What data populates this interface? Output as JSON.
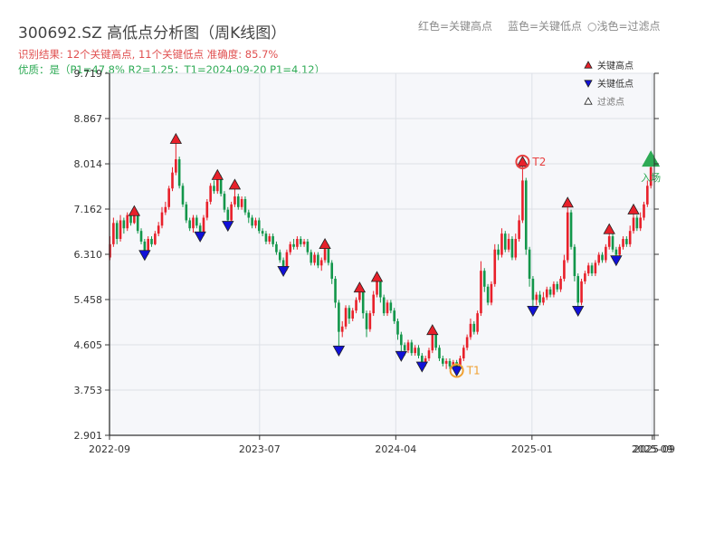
{
  "title": "300692.SZ 高低点分析图（周K线图）",
  "legend_top": {
    "red": "红色=关键高点",
    "blue": "蓝色=关键低点",
    "gray": "○浅色=过滤点"
  },
  "info_line1": "识别结果: 12个关键高点, 11个关键低点  准确度: 85.7%",
  "info_line2": "优质：是（P1=47.8%  R2=1.25；T1=2024-09-20 P1=4.12）",
  "colors": {
    "up": "#e8202a",
    "down": "#12964a",
    "high_marker": "#e8202a",
    "low_marker": "#1010d8",
    "t1": "#f0a030",
    "t2": "#e84040",
    "entry": "#2eaa55",
    "plot_bg": "#f6f7fa",
    "grid": "#dde1e7"
  },
  "chart_data": {
    "type": "candlestick",
    "legend": {
      "placement": "top-right",
      "entries": [
        "关键高点",
        "关键低点",
        "过滤点"
      ]
    },
    "y_ticks": [
      "2.901",
      "3.753",
      "4.605",
      "5.458",
      "6.310",
      "7.162",
      "8.014",
      "8.867",
      "9.719"
    ],
    "ylim": [
      2.901,
      9.719
    ],
    "x_ticks": [
      {
        "label": "2022-09",
        "date": "2022-09-01"
      },
      {
        "label": "2023-07",
        "date": "2023-07-01"
      },
      {
        "label": "2024-04",
        "date": "2024-04-01"
      },
      {
        "label": "2025-01",
        "date": "2025-01-01"
      },
      {
        "label": "2025-09",
        "date": "2025-09-01"
      },
      {
        "label": "2025-09",
        "date": "2025-09-05"
      }
    ],
    "xlim": [
      "2022-09-01",
      "2025-09-05"
    ],
    "grid": true,
    "candles": [
      [
        "2022-09-02",
        6.25,
        6.5,
        6.65,
        6.2
      ],
      [
        "2022-09-09",
        6.5,
        6.9,
        7.0,
        6.45
      ],
      [
        "2022-09-16",
        6.9,
        6.6,
        6.95,
        6.5
      ],
      [
        "2022-09-23",
        6.6,
        6.95,
        7.05,
        6.55
      ],
      [
        "2022-09-30",
        6.95,
        6.8,
        7.0,
        6.7
      ],
      [
        "2022-10-07",
        6.8,
        7.05,
        7.1,
        6.75
      ],
      [
        "2022-10-14",
        7.05,
        6.9,
        7.1,
        6.85
      ],
      [
        "2022-10-21",
        6.9,
        7.05,
        7.12,
        6.88
      ],
      [
        "2022-10-28",
        7.05,
        6.75,
        7.08,
        6.7
      ],
      [
        "2022-11-04",
        6.75,
        6.55,
        6.8,
        6.5
      ],
      [
        "2022-11-11",
        6.55,
        6.35,
        6.6,
        6.3
      ],
      [
        "2022-11-18",
        6.35,
        6.6,
        6.65,
        6.3
      ],
      [
        "2022-11-25",
        6.6,
        6.5,
        6.65,
        6.45
      ],
      [
        "2022-12-02",
        6.5,
        6.7,
        6.75,
        6.48
      ],
      [
        "2022-12-09",
        6.7,
        6.85,
        6.92,
        6.65
      ],
      [
        "2022-12-16",
        6.85,
        7.1,
        7.2,
        6.8
      ],
      [
        "2022-12-23",
        7.1,
        7.2,
        7.3,
        7.05
      ],
      [
        "2022-12-30",
        7.2,
        7.55,
        7.6,
        7.15
      ],
      [
        "2023-01-06",
        7.55,
        7.85,
        7.95,
        7.5
      ],
      [
        "2023-01-13",
        7.85,
        8.1,
        8.48,
        7.8
      ],
      [
        "2023-01-20",
        8.1,
        7.6,
        8.15,
        7.55
      ],
      [
        "2023-01-27",
        7.6,
        7.25,
        7.65,
        7.2
      ],
      [
        "2023-02-03",
        7.25,
        6.95,
        7.3,
        6.9
      ],
      [
        "2023-02-10",
        6.95,
        6.8,
        7.0,
        6.75
      ],
      [
        "2023-02-17",
        6.8,
        7.0,
        7.05,
        6.72
      ],
      [
        "2023-02-24",
        7.0,
        6.85,
        7.05,
        6.8
      ],
      [
        "2023-03-03",
        6.85,
        6.7,
        6.9,
        6.65
      ],
      [
        "2023-03-10",
        6.7,
        7.0,
        7.05,
        6.65
      ],
      [
        "2023-03-17",
        7.0,
        7.3,
        7.35,
        6.95
      ],
      [
        "2023-03-24",
        7.3,
        7.6,
        7.65,
        7.25
      ],
      [
        "2023-03-31",
        7.6,
        7.5,
        7.7,
        7.45
      ],
      [
        "2023-04-07",
        7.5,
        7.75,
        7.8,
        7.45
      ],
      [
        "2023-04-14",
        7.75,
        7.45,
        7.8,
        7.4
      ],
      [
        "2023-04-21",
        7.45,
        7.15,
        7.5,
        7.1
      ],
      [
        "2023-04-28",
        7.15,
        6.95,
        7.2,
        6.85
      ],
      [
        "2023-05-05",
        6.95,
        7.25,
        7.3,
        6.9
      ],
      [
        "2023-05-12",
        7.25,
        7.4,
        7.62,
        7.2
      ],
      [
        "2023-05-19",
        7.4,
        7.2,
        7.45,
        7.15
      ],
      [
        "2023-05-26",
        7.2,
        7.35,
        7.4,
        7.15
      ],
      [
        "2023-06-02",
        7.35,
        7.1,
        7.4,
        7.05
      ],
      [
        "2023-06-09",
        7.1,
        7.0,
        7.15,
        6.9
      ],
      [
        "2023-06-16",
        7.0,
        6.85,
        7.05,
        6.8
      ],
      [
        "2023-06-23",
        6.85,
        6.95,
        7.0,
        6.8
      ],
      [
        "2023-06-30",
        6.95,
        6.75,
        7.0,
        6.7
      ],
      [
        "2023-07-07",
        6.75,
        6.7,
        6.8,
        6.65
      ],
      [
        "2023-07-14",
        6.7,
        6.55,
        6.75,
        6.5
      ],
      [
        "2023-07-21",
        6.55,
        6.65,
        6.7,
        6.5
      ],
      [
        "2023-07-28",
        6.65,
        6.5,
        6.7,
        6.45
      ],
      [
        "2023-08-04",
        6.5,
        6.35,
        6.55,
        6.3
      ],
      [
        "2023-08-11",
        6.35,
        6.2,
        6.4,
        6.15
      ],
      [
        "2023-08-18",
        6.2,
        6.05,
        6.25,
        6.0
      ],
      [
        "2023-08-25",
        6.05,
        6.35,
        6.4,
        6.0
      ],
      [
        "2023-09-01",
        6.35,
        6.5,
        6.55,
        6.3
      ],
      [
        "2023-09-08",
        6.5,
        6.45,
        6.6,
        6.4
      ],
      [
        "2023-09-15",
        6.45,
        6.6,
        6.65,
        6.4
      ],
      [
        "2023-09-22",
        6.6,
        6.5,
        6.65,
        6.45
      ],
      [
        "2023-09-29",
        6.5,
        6.55,
        6.6,
        6.45
      ],
      [
        "2023-10-06",
        6.55,
        6.35,
        6.6,
        6.3
      ],
      [
        "2023-10-13",
        6.35,
        6.15,
        6.4,
        6.1
      ],
      [
        "2023-10-20",
        6.15,
        6.3,
        6.35,
        6.1
      ],
      [
        "2023-10-27",
        6.3,
        6.1,
        6.35,
        6.05
      ],
      [
        "2023-11-03",
        6.1,
        6.2,
        6.25,
        6.0
      ],
      [
        "2023-11-10",
        6.2,
        6.45,
        6.5,
        6.15
      ],
      [
        "2023-11-17",
        6.45,
        6.15,
        6.5,
        6.1
      ],
      [
        "2023-11-24",
        6.15,
        5.85,
        6.2,
        5.75
      ],
      [
        "2023-12-01",
        5.85,
        5.4,
        5.9,
        5.3
      ],
      [
        "2023-12-08",
        5.4,
        4.85,
        5.45,
        4.5
      ],
      [
        "2023-12-15",
        4.85,
        4.95,
        5.05,
        4.75
      ],
      [
        "2023-12-22",
        4.95,
        5.3,
        5.35,
        4.9
      ],
      [
        "2023-12-29",
        5.3,
        5.1,
        5.35,
        5.0
      ],
      [
        "2024-01-05",
        5.1,
        5.25,
        5.3,
        5.05
      ],
      [
        "2024-01-12",
        5.25,
        5.45,
        5.5,
        5.2
      ],
      [
        "2024-01-19",
        5.45,
        5.6,
        5.68,
        5.4
      ],
      [
        "2024-01-26",
        5.6,
        5.2,
        5.65,
        5.1
      ],
      [
        "2024-02-02",
        5.2,
        4.9,
        5.25,
        4.75
      ],
      [
        "2024-02-09",
        4.9,
        5.2,
        5.25,
        4.85
      ],
      [
        "2024-02-16",
        5.2,
        5.55,
        5.62,
        5.15
      ],
      [
        "2024-02-23",
        5.55,
        5.8,
        5.88,
        5.5
      ],
      [
        "2024-03-01",
        5.8,
        5.5,
        5.85,
        5.4
      ],
      [
        "2024-03-08",
        5.5,
        5.2,
        5.55,
        5.15
      ],
      [
        "2024-03-15",
        5.2,
        5.4,
        5.45,
        5.15
      ],
      [
        "2024-03-22",
        5.4,
        5.25,
        5.45,
        5.2
      ],
      [
        "2024-03-29",
        5.25,
        5.05,
        5.3,
        5.0
      ],
      [
        "2024-04-05",
        5.05,
        4.8,
        5.1,
        4.7
      ],
      [
        "2024-04-12",
        4.8,
        4.6,
        4.85,
        4.4
      ],
      [
        "2024-04-19",
        4.6,
        4.5,
        4.65,
        4.4
      ],
      [
        "2024-04-26",
        4.5,
        4.65,
        4.7,
        4.45
      ],
      [
        "2024-05-03",
        4.65,
        4.45,
        4.7,
        4.4
      ],
      [
        "2024-05-10",
        4.45,
        4.55,
        4.6,
        4.4
      ],
      [
        "2024-05-17",
        4.55,
        4.4,
        4.6,
        4.35
      ],
      [
        "2024-05-24",
        4.4,
        4.25,
        4.45,
        4.2
      ],
      [
        "2024-05-31",
        4.25,
        4.35,
        4.4,
        4.2
      ],
      [
        "2024-06-07",
        4.35,
        4.5,
        4.55,
        4.3
      ],
      [
        "2024-06-14",
        4.5,
        4.8,
        4.88,
        4.45
      ],
      [
        "2024-06-21",
        4.8,
        4.55,
        4.85,
        4.5
      ],
      [
        "2024-06-28",
        4.55,
        4.35,
        4.6,
        4.3
      ],
      [
        "2024-07-05",
        4.35,
        4.25,
        4.4,
        4.2
      ],
      [
        "2024-07-12",
        4.25,
        4.3,
        4.35,
        4.15
      ],
      [
        "2024-07-19",
        4.3,
        4.2,
        4.35,
        4.15
      ],
      [
        "2024-07-26",
        4.2,
        4.28,
        4.32,
        4.15
      ],
      [
        "2024-08-02",
        4.28,
        4.18,
        4.32,
        4.12
      ],
      [
        "2024-08-09",
        4.18,
        4.35,
        4.4,
        4.15
      ],
      [
        "2024-08-16",
        4.35,
        4.55,
        4.6,
        4.3
      ],
      [
        "2024-08-23",
        4.55,
        4.75,
        4.8,
        4.5
      ],
      [
        "2024-08-30",
        4.75,
        5.0,
        5.1,
        4.7
      ],
      [
        "2024-09-06",
        5.0,
        4.85,
        5.05,
        4.8
      ],
      [
        "2024-09-13",
        4.85,
        5.2,
        5.25,
        4.8
      ],
      [
        "2024-09-20",
        5.2,
        6.0,
        6.18,
        5.15
      ],
      [
        "2024-09-27",
        6.0,
        5.7,
        6.05,
        5.6
      ],
      [
        "2024-10-04",
        5.7,
        5.4,
        5.75,
        5.35
      ],
      [
        "2024-10-11",
        5.4,
        5.75,
        5.8,
        5.35
      ],
      [
        "2024-10-18",
        5.75,
        6.4,
        6.5,
        5.7
      ],
      [
        "2024-10-25",
        6.4,
        6.3,
        6.5,
        6.2
      ],
      [
        "2024-11-01",
        6.3,
        6.7,
        6.8,
        6.25
      ],
      [
        "2024-11-08",
        6.7,
        6.4,
        6.75,
        6.35
      ],
      [
        "2024-11-15",
        6.4,
        6.6,
        6.7,
        6.35
      ],
      [
        "2024-11-22",
        6.6,
        6.25,
        6.65,
        6.2
      ],
      [
        "2024-11-29",
        6.25,
        6.6,
        6.7,
        6.2
      ],
      [
        "2024-12-06",
        6.6,
        6.95,
        7.05,
        6.55
      ],
      [
        "2024-12-13",
        6.95,
        7.7,
        8.05,
        6.9
      ],
      [
        "2024-12-20",
        7.7,
        6.4,
        7.75,
        6.3
      ],
      [
        "2024-12-27",
        6.4,
        5.85,
        6.45,
        5.7
      ],
      [
        "2025-01-03",
        5.85,
        5.45,
        5.9,
        5.25
      ],
      [
        "2025-01-10",
        5.45,
        5.55,
        5.6,
        5.35
      ],
      [
        "2025-01-17",
        5.55,
        5.4,
        5.62,
        5.35
      ],
      [
        "2025-01-24",
        5.4,
        5.5,
        5.6,
        5.35
      ],
      [
        "2025-01-31",
        5.5,
        5.65,
        5.7,
        5.45
      ],
      [
        "2025-02-07",
        5.65,
        5.55,
        5.7,
        5.5
      ],
      [
        "2025-02-14",
        5.55,
        5.75,
        5.8,
        5.5
      ],
      [
        "2025-02-21",
        5.75,
        5.65,
        5.8,
        5.6
      ],
      [
        "2025-02-28",
        5.65,
        5.85,
        5.9,
        5.6
      ],
      [
        "2025-03-07",
        5.85,
        6.2,
        6.3,
        5.8
      ],
      [
        "2025-03-14",
        6.2,
        7.1,
        7.28,
        6.15
      ],
      [
        "2025-03-21",
        7.1,
        6.45,
        7.15,
        6.4
      ],
      [
        "2025-03-28",
        6.45,
        5.9,
        6.5,
        5.8
      ],
      [
        "2025-04-04",
        5.9,
        5.4,
        5.95,
        5.25
      ],
      [
        "2025-04-11",
        5.4,
        5.8,
        5.85,
        5.35
      ],
      [
        "2025-04-18",
        5.8,
        5.95,
        6.0,
        5.75
      ],
      [
        "2025-04-25",
        5.95,
        6.1,
        6.15,
        5.9
      ],
      [
        "2025-05-02",
        6.1,
        5.95,
        6.15,
        5.9
      ],
      [
        "2025-05-09",
        5.95,
        6.15,
        6.2,
        5.9
      ],
      [
        "2025-05-16",
        6.15,
        6.3,
        6.35,
        6.1
      ],
      [
        "2025-05-23",
        6.3,
        6.2,
        6.35,
        6.15
      ],
      [
        "2025-05-30",
        6.2,
        6.45,
        6.5,
        6.15
      ],
      [
        "2025-06-06",
        6.45,
        6.65,
        6.78,
        6.4
      ],
      [
        "2025-06-13",
        6.65,
        6.4,
        6.7,
        6.35
      ],
      [
        "2025-06-20",
        6.4,
        6.3,
        6.45,
        6.2
      ],
      [
        "2025-06-27",
        6.3,
        6.45,
        6.5,
        6.25
      ],
      [
        "2025-07-04",
        6.45,
        6.6,
        6.65,
        6.4
      ],
      [
        "2025-07-11",
        6.6,
        6.5,
        6.65,
        6.45
      ],
      [
        "2025-07-18",
        6.5,
        6.75,
        6.85,
        6.45
      ],
      [
        "2025-07-25",
        6.75,
        7.0,
        7.15,
        6.7
      ],
      [
        "2025-08-01",
        7.0,
        6.8,
        7.05,
        6.75
      ],
      [
        "2025-08-08",
        6.8,
        7.0,
        7.1,
        6.75
      ],
      [
        "2025-08-15",
        7.0,
        7.25,
        7.3,
        6.95
      ],
      [
        "2025-08-22",
        7.25,
        7.6,
        7.7,
        7.2
      ],
      [
        "2025-08-29",
        7.6,
        7.95,
        8.2,
        7.55
      ]
    ],
    "key_highs": [
      {
        "date": "2022-10-21",
        "price": 7.12
      },
      {
        "date": "2023-01-13",
        "price": 8.48
      },
      {
        "date": "2023-04-07",
        "price": 7.8
      },
      {
        "date": "2023-05-12",
        "price": 7.62
      },
      {
        "date": "2023-11-10",
        "price": 6.5
      },
      {
        "date": "2024-01-19",
        "price": 5.68
      },
      {
        "date": "2024-02-23",
        "price": 5.88
      },
      {
        "date": "2024-06-14",
        "price": 4.88
      },
      {
        "date": "2024-12-13",
        "price": 8.05
      },
      {
        "date": "2025-03-14",
        "price": 7.28
      },
      {
        "date": "2025-06-06",
        "price": 6.78
      },
      {
        "date": "2025-07-25",
        "price": 7.15
      }
    ],
    "key_lows": [
      {
        "date": "2022-11-11",
        "price": 6.3
      },
      {
        "date": "2023-03-03",
        "price": 6.65
      },
      {
        "date": "2023-04-28",
        "price": 6.85
      },
      {
        "date": "2023-08-18",
        "price": 6.0
      },
      {
        "date": "2023-12-08",
        "price": 4.5
      },
      {
        "date": "2024-04-12",
        "price": 4.4
      },
      {
        "date": "2024-05-24",
        "price": 4.2
      },
      {
        "date": "2024-08-02",
        "price": 4.12
      },
      {
        "date": "2025-01-03",
        "price": 5.25
      },
      {
        "date": "2025-04-04",
        "price": 5.25
      },
      {
        "date": "2025-06-20",
        "price": 6.2
      }
    ],
    "t1": {
      "label": "T1",
      "date": "2024-08-02",
      "price": 4.12
    },
    "t2": {
      "label": "T2",
      "date": "2024-12-13",
      "price": 8.05
    },
    "entry": {
      "label": "入场",
      "date": "2025-08-29",
      "price": 8.2
    }
  }
}
